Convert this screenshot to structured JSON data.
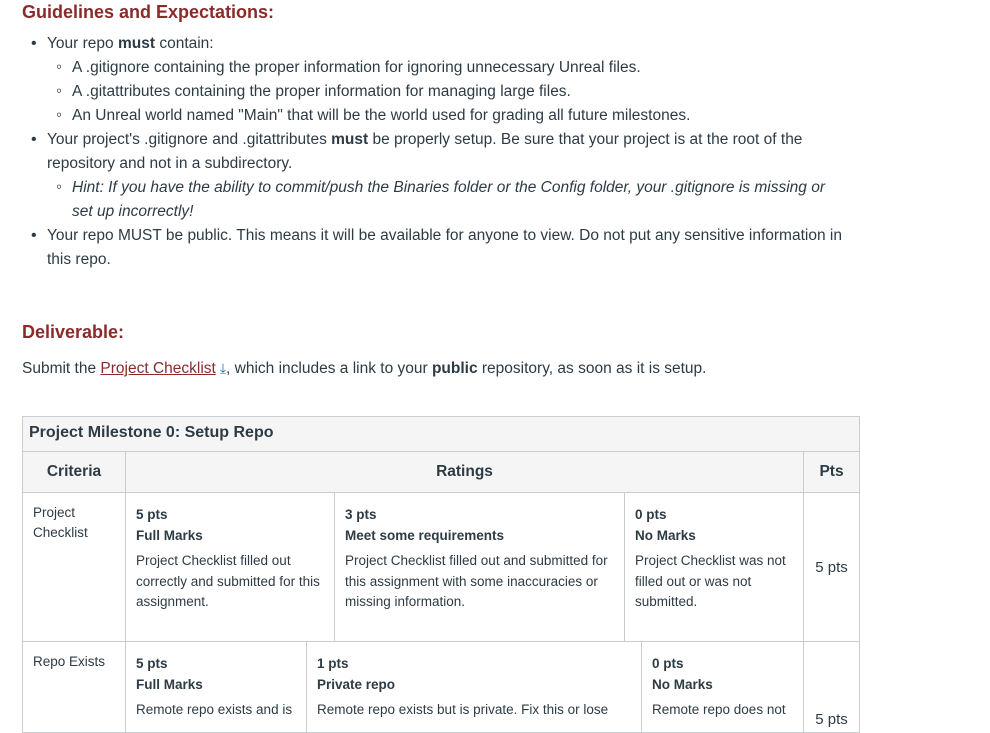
{
  "guidelines": {
    "heading": "Guidelines and Expectations:",
    "item1": {
      "prefix": "Your repo ",
      "bold": "must",
      "suffix": " contain:",
      "sub": [
        "A .gitignore containing the proper information for ignoring unnecessary Unreal files.",
        "A .gitattributes containing the proper information for managing large files.",
        "An Unreal world named \"Main\" that will be the world used for grading all future milestones."
      ]
    },
    "item2": {
      "prefix": "Your project's .gitignore and .gitattributes ",
      "bold": "must",
      "suffix": " be properly setup. Be sure that your project is at the root of the repository and not in a subdirectory.",
      "hint": "Hint: If you have the ability to commit/push the Binaries folder or the Config folder, your .gitignore is missing or set up incorrectly!"
    },
    "item3": "Your repo MUST be public. This means it will be available for anyone to view. Do not put any sensitive information in this repo."
  },
  "deliverable": {
    "heading": "Deliverable:",
    "prefix": "Submit the ",
    "link": "Project Checklist",
    "middle": ", which includes a link to your ",
    "bold": "public",
    "suffix": " repository, as soon as it is setup.",
    "download_icon": "download-arrow-icon"
  },
  "rubric": {
    "title": "Project Milestone 0: Setup Repo",
    "headers": {
      "criteria": "Criteria",
      "ratings": "Ratings",
      "pts": "Pts"
    },
    "rows": [
      {
        "criterion": "Project Checklist",
        "pts": "5 pts",
        "ratings": [
          {
            "pts": "5 pts",
            "title": "Full Marks",
            "desc": "Project Checklist filled out correctly and submitted for this assignment."
          },
          {
            "pts": "3 pts",
            "title": "Meet some requirements",
            "desc": "Project Checklist filled out and submitted for this assignment with some inaccuracies or missing information."
          },
          {
            "pts": "0 pts",
            "title": "No Marks",
            "desc": "Project Checklist was not filled out or was not submitted."
          }
        ]
      },
      {
        "criterion": "Repo Exists",
        "pts": "5 pts",
        "ratings": [
          {
            "pts": "5 pts",
            "title": "Full Marks",
            "desc": "Remote repo exists and is"
          },
          {
            "pts": "1 pts",
            "title": "Private repo",
            "desc": "Remote repo exists but is private. Fix this or lose"
          },
          {
            "pts": "0 pts",
            "title": "No Marks",
            "desc": "Remote repo does not"
          }
        ]
      }
    ]
  }
}
